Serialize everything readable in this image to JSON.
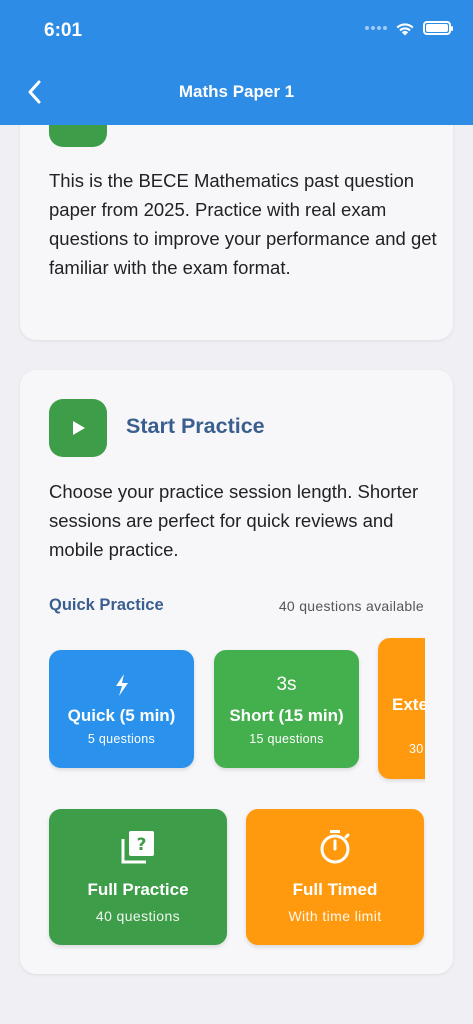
{
  "status_bar": {
    "time": "6:01"
  },
  "header": {
    "title": "Maths Paper 1"
  },
  "about": {
    "text": "This is the BECE Mathematics past question paper from 2025. Practice with real exam questions to improve your performance and get familiar with the exam format."
  },
  "start_practice": {
    "title": "Start Practice",
    "text": "Choose your practice session length. Shorter sessions are perfect for quick reviews and mobile practice.",
    "quick_label": "Quick Practice",
    "available": "40 questions available",
    "quick_options": [
      {
        "icon": "lightning-icon",
        "title": "Quick (5 min)",
        "sub": "5 questions",
        "color": "#2A92EC"
      },
      {
        "icon_text": "3s",
        "title": "Short (15 min)",
        "sub": "15 questions",
        "color": "#44AF4D"
      },
      {
        "title": "Exte",
        "sub": "30",
        "color": "#FF9A0E"
      }
    ],
    "full_options": [
      {
        "icon": "quiz-icon",
        "title": "Full Practice",
        "sub": "40 questions",
        "color": "#3E9D49"
      },
      {
        "icon": "timer-icon",
        "title": "Full Timed",
        "sub": "With time limit",
        "color": "#FF9A0E"
      }
    ]
  }
}
